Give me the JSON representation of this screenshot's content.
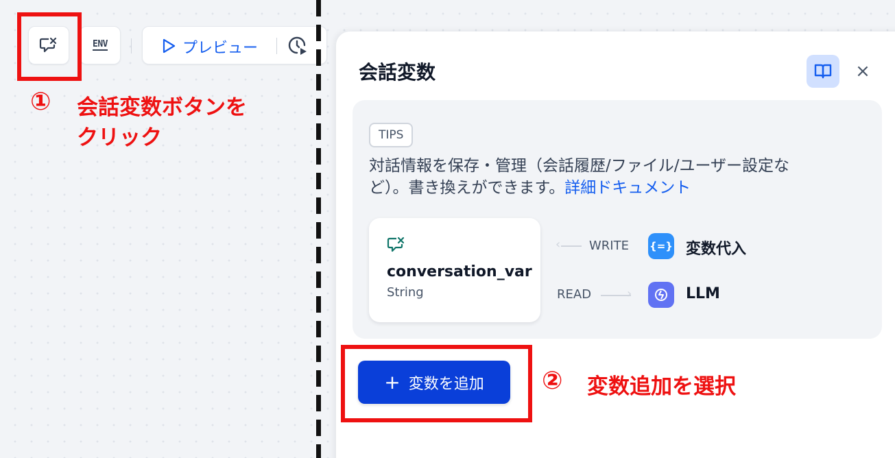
{
  "toolbar": {
    "env_label": "ENV",
    "preview_label": "プレビュー"
  },
  "annotations": {
    "step1_number": "①",
    "step1_line1": "会話変数ボタンを",
    "step1_line2": "クリック",
    "step2_number": "②",
    "step2_text": "変数追加を選択"
  },
  "panel": {
    "title": "会話変数",
    "close_symbol": "×",
    "tips": {
      "badge": "TIPS",
      "text_line1": "対話情報を保存・管理（会話履歴/ファイル/ユーザー設定な",
      "text_line2": "ど）。書き換えができます。",
      "link_text": "詳細ドキュメント"
    },
    "variable": {
      "name": "conversation_var",
      "type": "String"
    },
    "write_label": "WRITE",
    "read_label": "READ",
    "write_node": {
      "label": "変数代入",
      "icon_text": "{=}"
    },
    "read_node": {
      "label": "LLM"
    },
    "add_button_label": "変数を追加",
    "add_button_icon": "+"
  },
  "colors": {
    "accent": "#155eef",
    "button_primary": "#0a3fd9",
    "annotation_red": "#ee1111",
    "conversation_icon": "#107569",
    "assign_node": "#2e90fa",
    "llm_node": "#6172f3"
  },
  "icons": {
    "conversation_var_button": "conversation-var-icon",
    "env_button": "env-icon",
    "preview": "play-icon",
    "history": "history-play-icon",
    "docs": "book-icon",
    "close": "close-icon",
    "variable": "conversation-var-icon",
    "assign": "variable-assign-icon",
    "llm": "llm-icon",
    "add": "plus-icon"
  }
}
